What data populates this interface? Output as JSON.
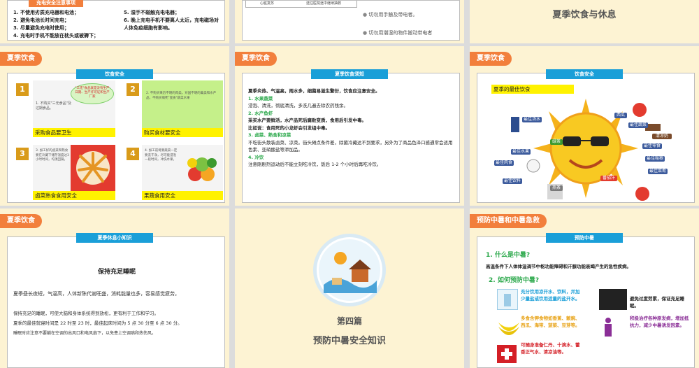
{
  "slide1": {
    "header": "充电安全注意事项",
    "items_left": [
      "1. 不使用劣质充电器和电池；",
      "2. 避免电池长时间充电；",
      "3. 尽量避免充电时使用；",
      "4. 充电时手机不能放在枕头或被褥下；"
    ],
    "items_right": [
      "5. 湿手不碰触充电电器；",
      "6. 晚上充电手机不要离人太近，充电磁场对人体免疫细胞有影响。"
    ]
  },
  "slide2": {
    "table_left": "心脏复苏",
    "table_right": "送往医院途中继续抽救",
    "bullets": [
      "切勿用手触及带电者。",
      "切勿用潮湿的物件搬动带电者"
    ]
  },
  "slide3": {
    "title": "夏季饮食与休息"
  },
  "slide4": {
    "tag": "夏季饮食",
    "tab": "饮食安全",
    "cells": [
      {
        "num": "1",
        "caption": "采购食品要卫生",
        "bubble": "\"三无\"食品就是没有生产日期、生产许可证和生产厂家",
        "note": "1. 不购买\"三无食品\"及过期食品。"
      },
      {
        "num": "2",
        "caption": "购买食材要安全",
        "note": "2. 不购买来历不明的肉类。对国不明的禽类和水产品，不购买病死\"变质\"蔬菜水果"
      },
      {
        "num": "3",
        "caption": "卤菜熟食食用安全",
        "note": "3. 加工好的卤菜和熟食要在冷藏下储存温度过3小时时间，均须回锅。"
      },
      {
        "num": "4",
        "caption": "果蔬食用安全",
        "note": "4. 加工前将要蔬菜一定要洗干净，尽可能浸泡一段时间，冲洗水果。"
      }
    ]
  },
  "slide5": {
    "tag": "夏季饮食",
    "tab": "夏季饮食须知",
    "intro": "夏季炎热、气温高，雨水多，细菌易滋生繁衍，饮食应注意安全。",
    "sections": [
      {
        "title": "1. 水果蔬菜",
        "body": "浸泡、清洗，彻底清洗，多洗几遍去除农药残余。"
      },
      {
        "title": "2. 水产鱼虾",
        "body": "采买水产要鲜活，水产品死后腐败变质，食用后引发中毒。",
        "body2": "比如说：食用死的小龙虾会引发组中毒。"
      },
      {
        "title": "3. 卤菜、熟食和凉菜",
        "body": "不吃街头散装卤菜、凉菜。街头摊点条件差，除菌冷藏达不到要求，另外为了商品色泽口感通常会适用色素、亚硝酸盐等添加品。"
      },
      {
        "title": "4. 冷饮",
        "body": "注意刚剧烈运动后不能立刻吃冷饮，饭后 1-2 个小时后再吃冷饮。"
      }
    ]
  },
  "slide6": {
    "tag": "夏季饮食",
    "tab": "饮食安全",
    "heading": "夏季的最佳饮食",
    "labels": [
      "最佳汤水",
      "最佳蔬菜",
      "西瓜",
      "最佳肉食",
      "最佳水果",
      "最佳粗粮",
      "最佳零食",
      "最佳饮料",
      "最佳菜肴",
      "绿茶",
      "番茄汁",
      "热茶",
      "清凉奶"
    ]
  },
  "slide7": {
    "tag": "夏季饮食",
    "tab": "夏季休息小知识",
    "heading": "保持充足睡眠",
    "p1": "夏季昼长夜短，气温高，人体新陈代谢旺盛，消耗能量也多，容易感觉疲劳。",
    "p2": "保持充足的睡眠，可使大脑和身体系统得到放松，更有利于工作和学习。",
    "p3": "夏季的最佳就寝时间是 22 时至 23 时，最佳起床时间为 5 点 30 分至 6 点 30 分。",
    "p4": "睡眠时应注意不要躺在空调的出风口和电风扇下，以免患上空调病和热伤风。"
  },
  "slide8": {
    "part": "第四篇",
    "title": "预防中暑安全知识"
  },
  "slide9": {
    "tag": "预防中暑和中暑急救",
    "tab": "预防中暑",
    "q1": "1. 什么是中暑?",
    "a1": "高温条件下人体体温调节中枢功能障碍和汗腺功能衰竭产生的急性疾病。",
    "q2": "2. 如何预防中暑?",
    "tips": [
      {
        "text": "充分饮用凉开水、饮料，并加少量盐或饮用适量的盐开水。",
        "color": "#1a9fd8"
      },
      {
        "text": "避免过度劳累，保证充足睡眠。",
        "color": "#222222"
      },
      {
        "text": "多食含钾食物如香蕉、赖豌、西瓜、海带、菠菜、豆芽等。",
        "color": "#e8a317"
      },
      {
        "text": "积极治疗各种原发病，增加抵抗力，减少中暑诱发因素。",
        "color": "#8b2f97"
      },
      {
        "text": "可随身准备仁丹、十滴水、藿香正气水、清凉油等。",
        "color": "#d41f26"
      }
    ]
  }
}
